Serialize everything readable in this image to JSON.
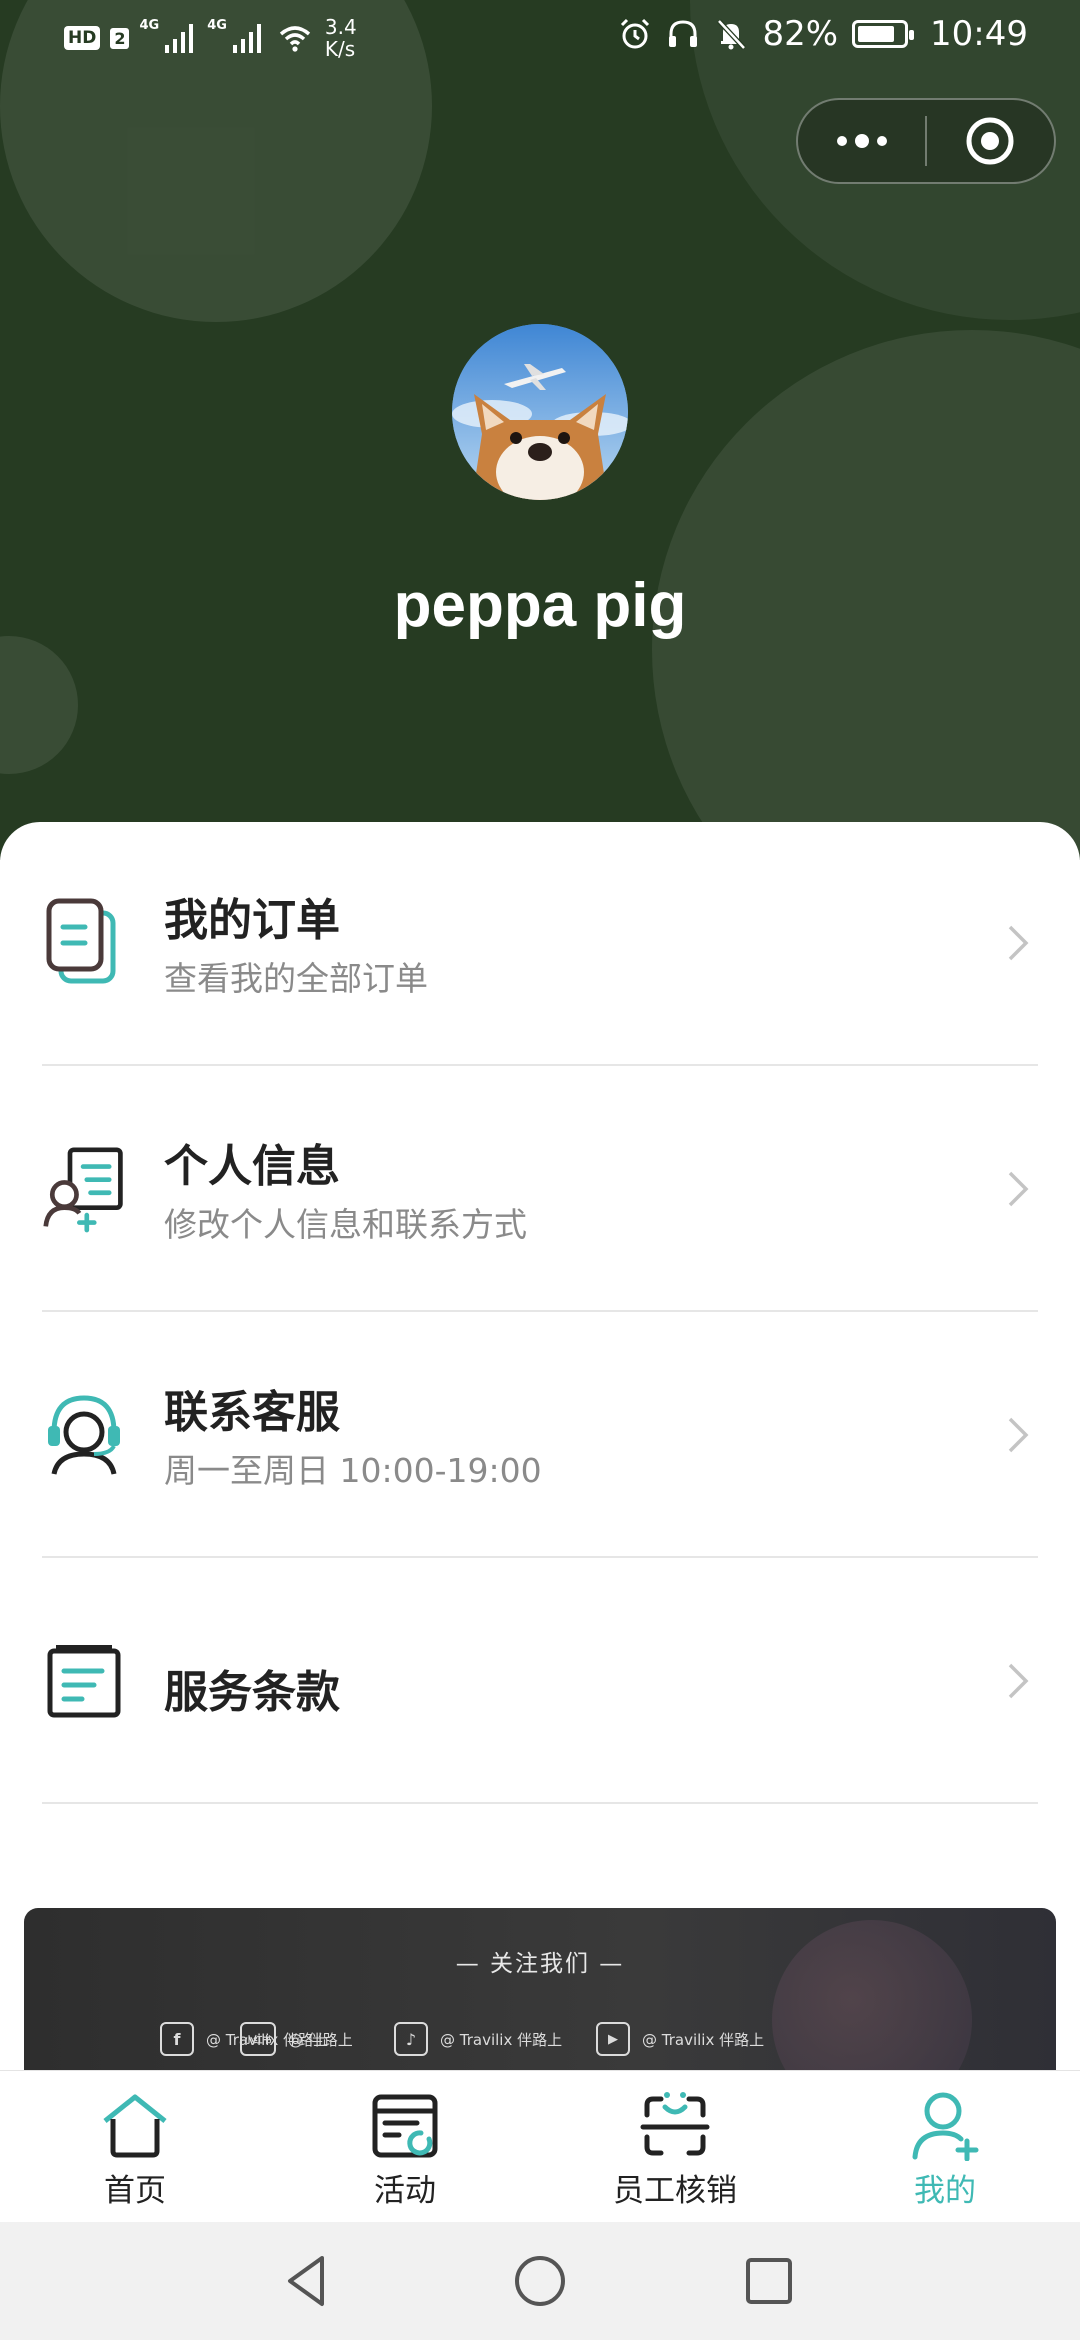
{
  "status_bar": {
    "hd": "HD",
    "sim": "2",
    "net1": "4G",
    "net2": "4G",
    "speed_value": "3.4",
    "speed_unit": "K/s",
    "battery_percent": "82%",
    "battery_level": 0.82,
    "time": "10:49"
  },
  "profile": {
    "username": "peppa pig"
  },
  "menu": [
    {
      "title": "我的订单",
      "subtitle": "查看我的全部订单",
      "icon": "orders-icon"
    },
    {
      "title": "个人信息",
      "subtitle": "修改个人信息和联系方式",
      "icon": "profile-info-icon"
    },
    {
      "title": "联系客服",
      "subtitle": "周一至周日 10:00-19:00",
      "icon": "customer-service-icon"
    },
    {
      "title": "服务条款",
      "subtitle": "",
      "icon": "terms-icon"
    }
  ],
  "banner": {
    "title": "— 关注我们 —",
    "socials": [
      {
        "icon_text": "f",
        "label": "@ Travilix 伴路上"
      },
      {
        "icon_text": "小红书",
        "label": "@ 伴路上"
      },
      {
        "icon_text": "♪",
        "label": "@ Travilix 伴路上"
      },
      {
        "icon_text": "▶",
        "label": "@ Travilix 伴路上"
      }
    ]
  },
  "tabs": [
    {
      "label": "首页",
      "icon": "home-icon"
    },
    {
      "label": "活动",
      "icon": "activity-icon"
    },
    {
      "label": "员工核销",
      "icon": "scan-verify-icon"
    },
    {
      "label": "我的",
      "icon": "my-profile-icon",
      "active": true
    }
  ],
  "colors": {
    "header_bg": "#263b22",
    "accent": "#3fb9b4"
  }
}
